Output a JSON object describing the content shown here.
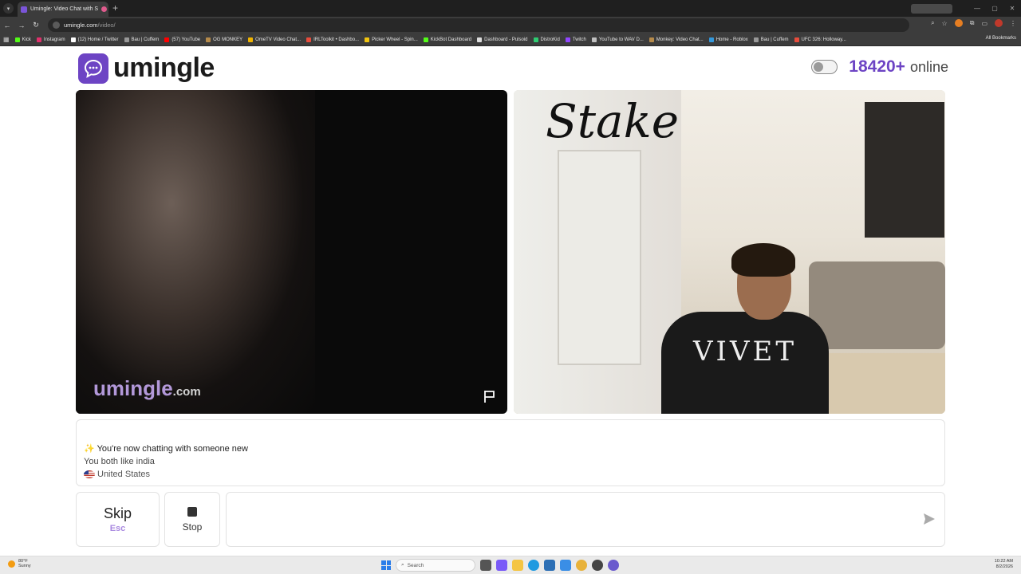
{
  "browser": {
    "tab_title": "Umingle: Video Chat with S",
    "url_host": "umingle.com",
    "url_path": "/video/",
    "bookmarks": [
      "Kick",
      "Instagram",
      "(12) Home / Twitter",
      "Bau | Cuffem",
      "(57) YouTube",
      "OG MONKEY",
      "OmeTV Video Chat...",
      "IRLToolkit • Dashbo...",
      "Picker Wheel - Spin...",
      "KickBot Dashboard",
      "Dashboard - Pulsoid",
      "DistroKid",
      "Twitch",
      "YouTube to WAV D...",
      "Monkey: Video Chat...",
      "Home - Roblox",
      "Bau | Cuffem",
      "UFC 326: Holloway..."
    ],
    "all_bookmarks": "All Bookmarks"
  },
  "header": {
    "brand": "umingle",
    "online_count": "18420+",
    "online_label": "online"
  },
  "video": {
    "watermark_main": "umingle",
    "watermark_suffix": ".com",
    "shirt_text": "VIVET"
  },
  "chat": {
    "system_emoji": "✨",
    "system_message": "You're now chatting with someone new",
    "shared_interest": "You both like india",
    "country": "United States"
  },
  "controls": {
    "skip_label": "Skip",
    "skip_hint": "Esc",
    "stop_label": "Stop",
    "message_placeholder": ""
  },
  "taskbar": {
    "weather_temp": "80°F",
    "weather_desc": "Sunny",
    "search_label": "Search",
    "time": "10:22 AM",
    "date": "8/2/2026"
  },
  "colors": {
    "brand_purple": "#6d44c4",
    "watermark_lavender": "#c4a7ef"
  }
}
